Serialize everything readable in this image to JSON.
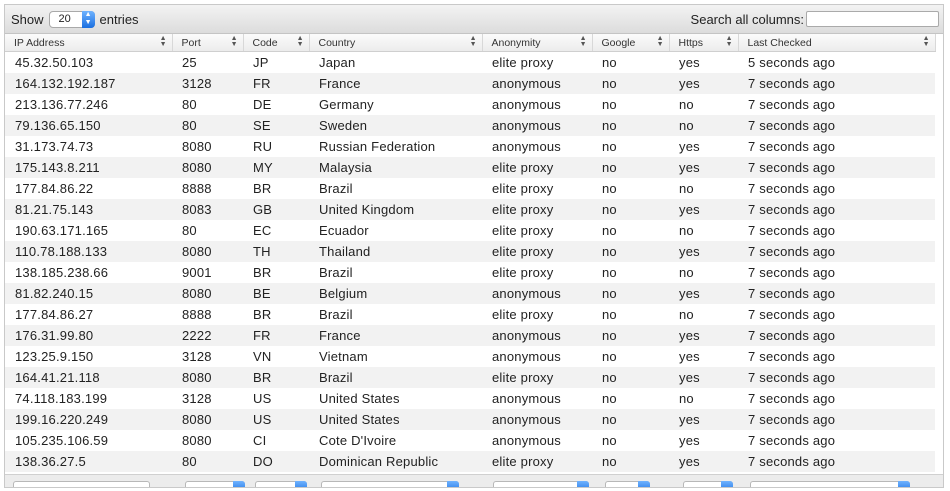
{
  "length_menu": {
    "show_label": "Show",
    "entries_label": "entries",
    "selected": "20"
  },
  "search": {
    "label": "Search all columns:",
    "value": ""
  },
  "columns": [
    "IP Address",
    "Port",
    "Code",
    "Country",
    "Anonymity",
    "Google",
    "Https",
    "Last Checked"
  ],
  "rows": [
    [
      "45.32.50.103",
      "25",
      "JP",
      "Japan",
      "elite proxy",
      "no",
      "yes",
      "5 seconds ago"
    ],
    [
      "164.132.192.187",
      "3128",
      "FR",
      "France",
      "anonymous",
      "no",
      "yes",
      "7 seconds ago"
    ],
    [
      "213.136.77.246",
      "80",
      "DE",
      "Germany",
      "anonymous",
      "no",
      "no",
      "7 seconds ago"
    ],
    [
      "79.136.65.150",
      "80",
      "SE",
      "Sweden",
      "anonymous",
      "no",
      "no",
      "7 seconds ago"
    ],
    [
      "31.173.74.73",
      "8080",
      "RU",
      "Russian Federation",
      "anonymous",
      "no",
      "yes",
      "7 seconds ago"
    ],
    [
      "175.143.8.211",
      "8080",
      "MY",
      "Malaysia",
      "elite proxy",
      "no",
      "yes",
      "7 seconds ago"
    ],
    [
      "177.84.86.22",
      "8888",
      "BR",
      "Brazil",
      "elite proxy",
      "no",
      "no",
      "7 seconds ago"
    ],
    [
      "81.21.75.143",
      "8083",
      "GB",
      "United Kingdom",
      "elite proxy",
      "no",
      "yes",
      "7 seconds ago"
    ],
    [
      "190.63.171.165",
      "80",
      "EC",
      "Ecuador",
      "elite proxy",
      "no",
      "no",
      "7 seconds ago"
    ],
    [
      "110.78.188.133",
      "8080",
      "TH",
      "Thailand",
      "elite proxy",
      "no",
      "yes",
      "7 seconds ago"
    ],
    [
      "138.185.238.66",
      "9001",
      "BR",
      "Brazil",
      "elite proxy",
      "no",
      "no",
      "7 seconds ago"
    ],
    [
      "81.82.240.15",
      "8080",
      "BE",
      "Belgium",
      "anonymous",
      "no",
      "yes",
      "7 seconds ago"
    ],
    [
      "177.84.86.27",
      "8888",
      "BR",
      "Brazil",
      "elite proxy",
      "no",
      "no",
      "7 seconds ago"
    ],
    [
      "176.31.99.80",
      "2222",
      "FR",
      "France",
      "anonymous",
      "no",
      "yes",
      "7 seconds ago"
    ],
    [
      "123.25.9.150",
      "3128",
      "VN",
      "Vietnam",
      "anonymous",
      "no",
      "yes",
      "7 seconds ago"
    ],
    [
      "164.41.21.118",
      "8080",
      "BR",
      "Brazil",
      "elite proxy",
      "no",
      "yes",
      "7 seconds ago"
    ],
    [
      "74.118.183.199",
      "3128",
      "US",
      "United States",
      "anonymous",
      "no",
      "no",
      "7 seconds ago"
    ],
    [
      "199.16.220.249",
      "8080",
      "US",
      "United States",
      "anonymous",
      "no",
      "yes",
      "7 seconds ago"
    ],
    [
      "105.235.106.59",
      "8080",
      "CI",
      "Cote D'Ivoire",
      "anonymous",
      "no",
      "yes",
      "7 seconds ago"
    ],
    [
      "138.36.27.5",
      "80",
      "DO",
      "Dominican Republic",
      "elite proxy",
      "no",
      "yes",
      "7 seconds ago"
    ]
  ],
  "icons": {
    "select_arrow": "chevron-up-down-icon",
    "sort": "sort-both-icon"
  },
  "colors": {
    "accent": "#1b6fe0",
    "row_alt": "#f2f2f2"
  }
}
